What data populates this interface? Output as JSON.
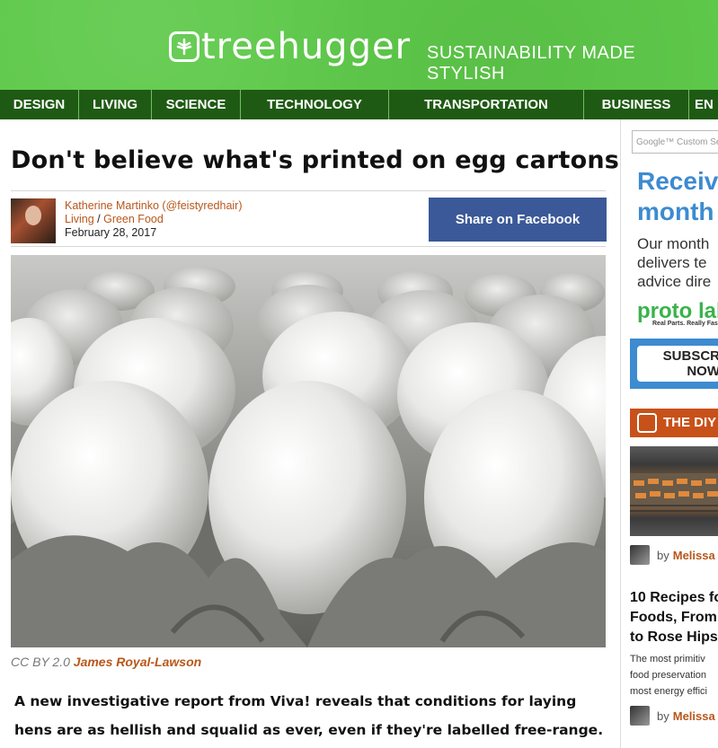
{
  "header": {
    "logo_text": "treehugger",
    "tagline": "SUSTAINABILITY MADE STYLISH",
    "brand_color": "#5ec94a",
    "nav_color": "#1f5a14"
  },
  "nav": {
    "items": [
      {
        "label": "DESIGN"
      },
      {
        "label": "LIVING"
      },
      {
        "label": "SCIENCE"
      },
      {
        "label": "TECHNOLOGY"
      },
      {
        "label": "TRANSPORTATION"
      },
      {
        "label": "BUSINESS"
      },
      {
        "label": "EN"
      }
    ]
  },
  "article": {
    "title": "Don't believe what's printed on egg cartons",
    "author": "Katherine Martinko",
    "author_handle": "(@feistyredhair)",
    "category": "Living",
    "category_sep": " / ",
    "subcategory": "Green Food",
    "date": "February 28, 2017",
    "share_label": "Share on Facebook",
    "caption_license": "CC BY 2.0",
    "caption_author": "James Royal-Lawson",
    "lede": "A new investigative report from Viva! reveals that conditions for laying hens are as hellish and squalid as ever, even if they're labelled free-range."
  },
  "sidebar": {
    "search_placeholder": "Google™ Custom Se",
    "promo_heading_1": "Receiv",
    "promo_heading_2": "month",
    "promo_text_1": "Our month",
    "promo_text_2": "delivers te",
    "promo_text_3": "advice dire",
    "sponsor_logo": "proto lab",
    "sponsor_tagline": "Real Parts. Really Fas",
    "subscribe_line_1": "SUBSCR",
    "subscribe_line_2": "NOW",
    "diy_label": "THE DIY",
    "by_prefix": "by",
    "by_author_1": "Melissa B",
    "rec_title_1": "10 Recipes fo",
    "rec_title_2": "Foods, From",
    "rec_title_3": "to Rose Hips",
    "rec_text_1": "The most primitiv",
    "rec_text_2": "food preservation",
    "rec_text_3": "most energy effici",
    "by_author_2": "Melissa B"
  }
}
